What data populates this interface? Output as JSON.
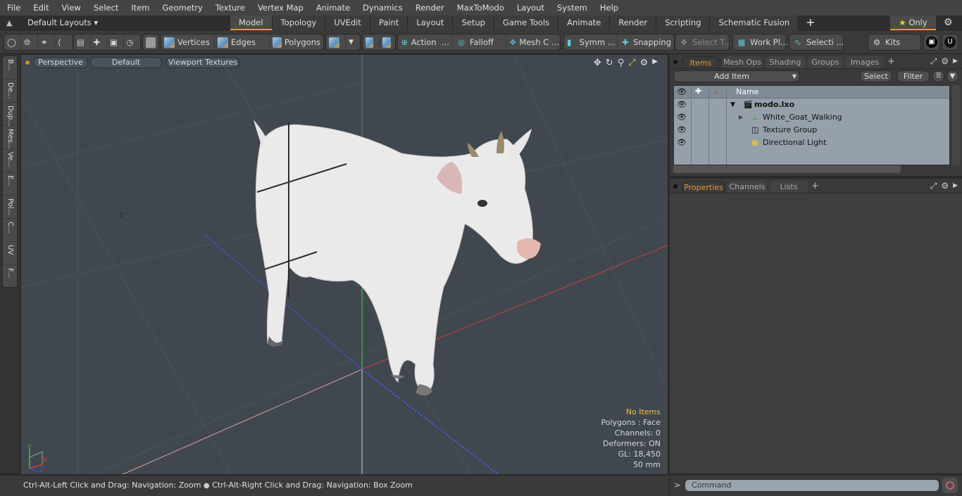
{
  "menu": [
    "File",
    "Edit",
    "View",
    "Select",
    "Item",
    "Geometry",
    "Texture",
    "Vertex Map",
    "Animate",
    "Dynamics",
    "Render",
    "MaxToModo",
    "Layout",
    "System",
    "Help"
  ],
  "layout_bar": {
    "layout_selector": "Default Layouts ▾",
    "tabs": [
      "Model",
      "Topology",
      "UVEdit",
      "Paint",
      "Layout",
      "Setup",
      "Game Tools",
      "Animate",
      "Render",
      "Scripting",
      "Schematic Fusion"
    ],
    "active_tab": "Model",
    "add_tab": "+",
    "only_label": "Only",
    "only_star": "★"
  },
  "toolbar": {
    "vertices": "Vertices",
    "edges": "Edges",
    "polygons": "Polygons",
    "action": "Action",
    "action_more": "...",
    "falloff": "Falloff",
    "mesh_c": "Mesh C ...",
    "symm": "Symm ...",
    "snapping": "Snapping",
    "select_t": "Select T...",
    "work_pl": "Work Pl...",
    "selecti": "Selecti ...",
    "kits": "Kits"
  },
  "left_tabs": [
    "B...",
    "De...",
    "Dup...",
    "Mes...",
    "Ve...",
    "E...",
    "Pol...",
    "C...",
    "UV",
    "F..."
  ],
  "viewport": {
    "view_mode": "Perspective",
    "shading": "Default",
    "textures": "Viewport Textures",
    "axis_label": "-Z",
    "stats": {
      "selection": "No Items",
      "polygons": "Polygons : Face",
      "channels": "Channels: 0",
      "deformers": "Deformers: ON",
      "gl": "GL: 18,450",
      "scale": "50 mm"
    },
    "gizmo": {
      "y": "Y",
      "x": "X",
      "z": "Z"
    },
    "colors": {
      "x_axis": "#c84040",
      "y_axis": "#40c040",
      "z_axis": "#4050d0",
      "bg": "#40474e"
    }
  },
  "items_panel": {
    "tabs": [
      "Items",
      "Mesh Ops",
      "Shading",
      "Groups",
      "Images"
    ],
    "active_tab": "Items",
    "add_tab": "+",
    "add_item": "Add Item",
    "select": "Select",
    "filter": "Filter",
    "header_name": "Name",
    "rows": [
      {
        "label": "modo.lxo",
        "bold": true
      },
      {
        "label": "White_Goat_Walking"
      },
      {
        "label": "Texture Group"
      },
      {
        "label": "Directional Light"
      }
    ]
  },
  "properties_panel": {
    "tabs": [
      "Properties",
      "Channels",
      "Lists"
    ],
    "active_tab": "Properties",
    "add_tab": "+"
  },
  "status": {
    "hint_left": "Ctrl-Alt-Left Click and Drag: Navigation: Zoom",
    "separator": "●",
    "hint_right": "Ctrl-Alt-Right Click and Drag: Navigation: Box Zoom"
  },
  "command": {
    "prompt": ">",
    "placeholder": "Command"
  },
  "accent_color": "#e8962e"
}
